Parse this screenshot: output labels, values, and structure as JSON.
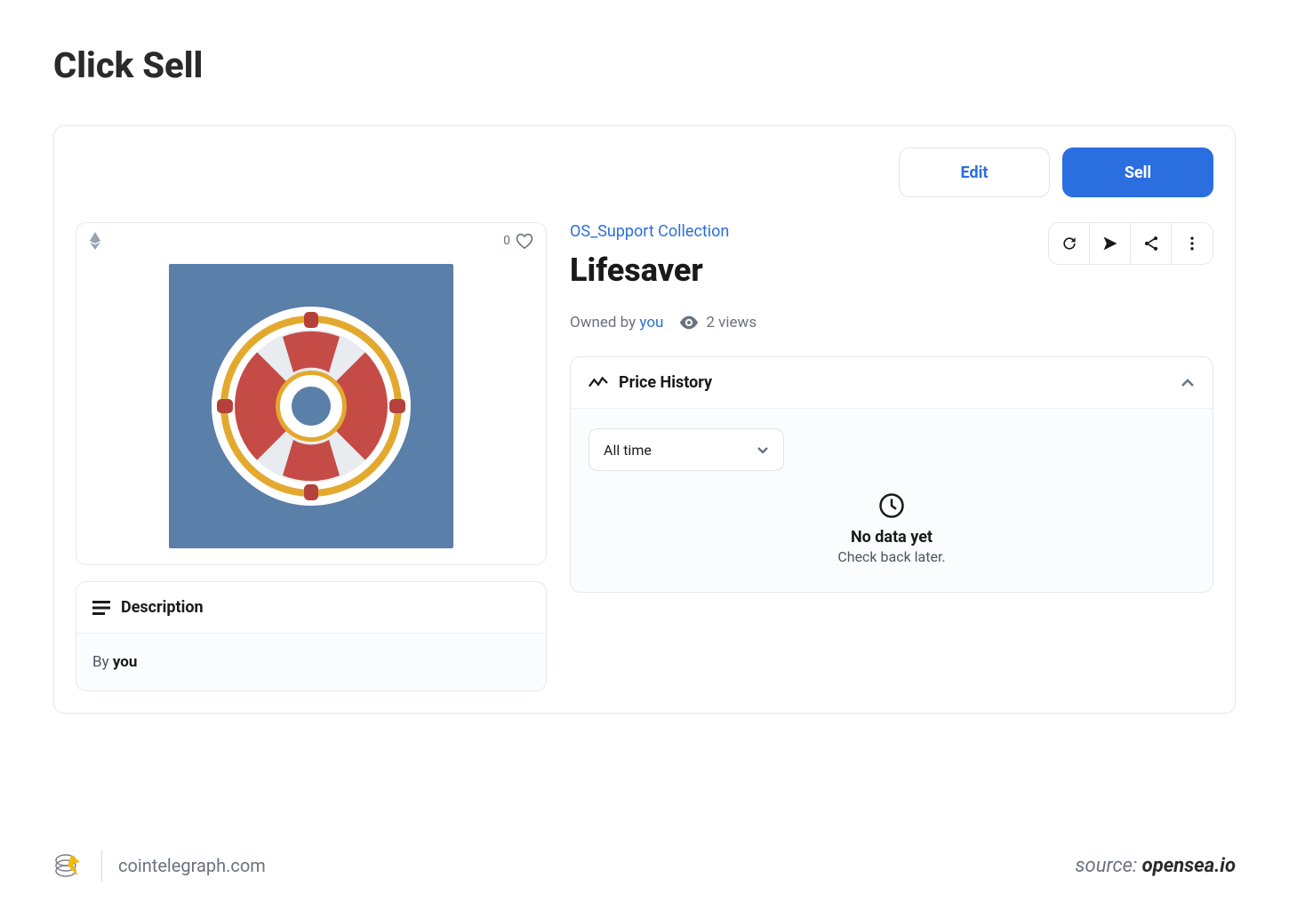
{
  "page_title": "Click Sell",
  "topbar": {
    "edit_label": "Edit",
    "sell_label": "Sell"
  },
  "media": {
    "likes_count": "0"
  },
  "description": {
    "header": "Description",
    "by_prefix": "By ",
    "by_who": "you"
  },
  "item": {
    "collection_name": "OS_Support Collection",
    "title": "Lifesaver",
    "owned_prefix": "Owned by ",
    "owned_by": "you",
    "views_text": "2 views"
  },
  "price_history": {
    "header": "Price History",
    "range_selected": "All time",
    "empty_title": "No data yet",
    "empty_sub": "Check back later."
  },
  "footer": {
    "site": "cointelegraph.com",
    "source_prefix": "source: ",
    "source_name": "opensea.io"
  }
}
